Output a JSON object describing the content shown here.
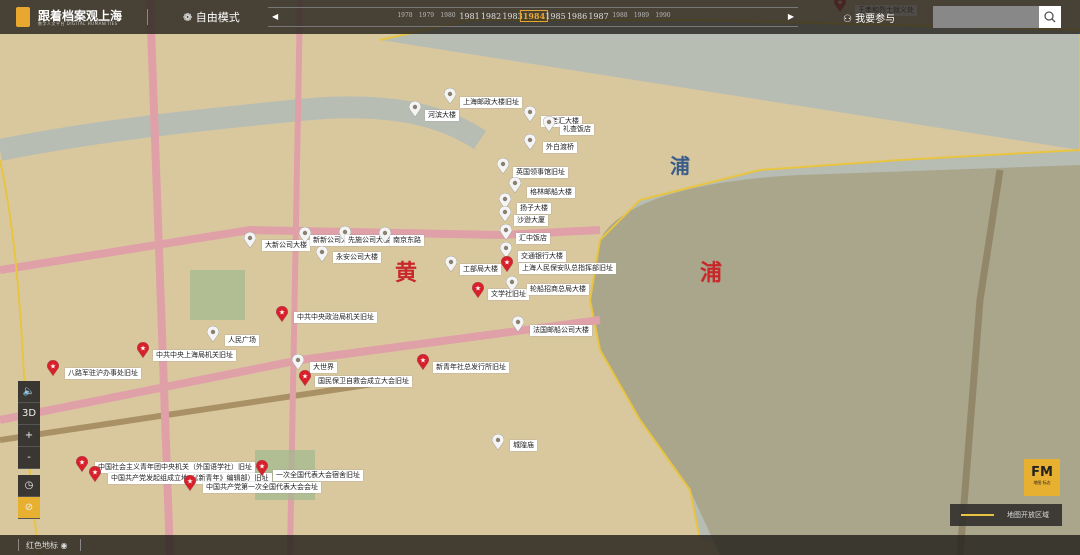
{
  "header": {
    "brand": "跟着档案观上海",
    "brand_sub": "数字人文平台 DIGITAL HUMANITIES",
    "mode": "自由模式",
    "participate": "我要参与",
    "search_placeholder": ""
  },
  "timeline": {
    "years": [
      "1978",
      "1979",
      "1980",
      "1981",
      "1982",
      "1983",
      "1984",
      "1985",
      "1986",
      "1987",
      "1988",
      "1989",
      "1990"
    ],
    "active": "1984"
  },
  "map_text": {
    "huang": "黄",
    "pu_red": "浦",
    "pu_river": "浦"
  },
  "landmarks": [
    {
      "name": "上海邮政大楼旧址",
      "type": "gray"
    },
    {
      "name": "河滨大楼",
      "type": "gray"
    },
    {
      "name": "百老汇大楼",
      "type": "gray"
    },
    {
      "name": "礼查饭店",
      "type": "gray"
    },
    {
      "name": "外白渡桥",
      "type": "gray"
    },
    {
      "name": "英国领事馆旧址",
      "type": "gray"
    },
    {
      "name": "格林邮船大楼",
      "type": "gray"
    },
    {
      "name": "扬子大楼",
      "type": "gray"
    },
    {
      "name": "沙逊大厦",
      "type": "gray"
    },
    {
      "name": "汇中饭店",
      "type": "gray"
    },
    {
      "name": "交通银行大楼",
      "type": "gray"
    },
    {
      "name": "上海人民保安队总指挥部旧址",
      "type": "red"
    },
    {
      "name": "工部局大楼",
      "type": "gray"
    },
    {
      "name": "文学社旧址",
      "type": "red"
    },
    {
      "name": "轮船招商总局大楼",
      "type": "gray"
    },
    {
      "name": "法国邮船公司大楼",
      "type": "gray"
    },
    {
      "name": "大新公司大楼",
      "type": "gray"
    },
    {
      "name": "新新公司大楼",
      "type": "gray"
    },
    {
      "name": "先施公司大楼",
      "type": "gray"
    },
    {
      "name": "南京东路",
      "type": "gray"
    },
    {
      "name": "永安公司大楼",
      "type": "gray"
    },
    {
      "name": "中共中央政治局机关旧址",
      "type": "red"
    },
    {
      "name": "人民广场",
      "type": "gray"
    },
    {
      "name": "中共中央上海局机关旧址",
      "type": "red"
    },
    {
      "name": "八路军驻沪办事处旧址",
      "type": "red"
    },
    {
      "name": "大世界",
      "type": "gray"
    },
    {
      "name": "国民保卫自救会成立大会旧址",
      "type": "red"
    },
    {
      "name": "新青年社总发行所旧址",
      "type": "red"
    },
    {
      "name": "城隍庙",
      "type": "gray"
    },
    {
      "name": "中国社会主义青年团中央机关（外国语学社）旧址",
      "type": "red"
    },
    {
      "name": "中国共产党发起组成立地（《新青年》编辑部）旧址",
      "type": "red"
    },
    {
      "name": "一次全国代表大会宿舍旧址",
      "type": "red"
    },
    {
      "name": "中国共产党第一次全国代表大会会址",
      "type": "red"
    },
    {
      "name": "王孝和烈士就义处",
      "type": "red"
    }
  ],
  "controls": {
    "three_d": "3D",
    "zoom_in": "+",
    "zoom_out": "-"
  },
  "bottom": {
    "red_landmarks": "红色地标"
  },
  "fm": {
    "mark": "FM",
    "sub": "地图 标志"
  },
  "legend": {
    "label": "地图开放区域"
  },
  "colors": {
    "accent": "#e8b030",
    "red_pin": "#d8202a"
  }
}
